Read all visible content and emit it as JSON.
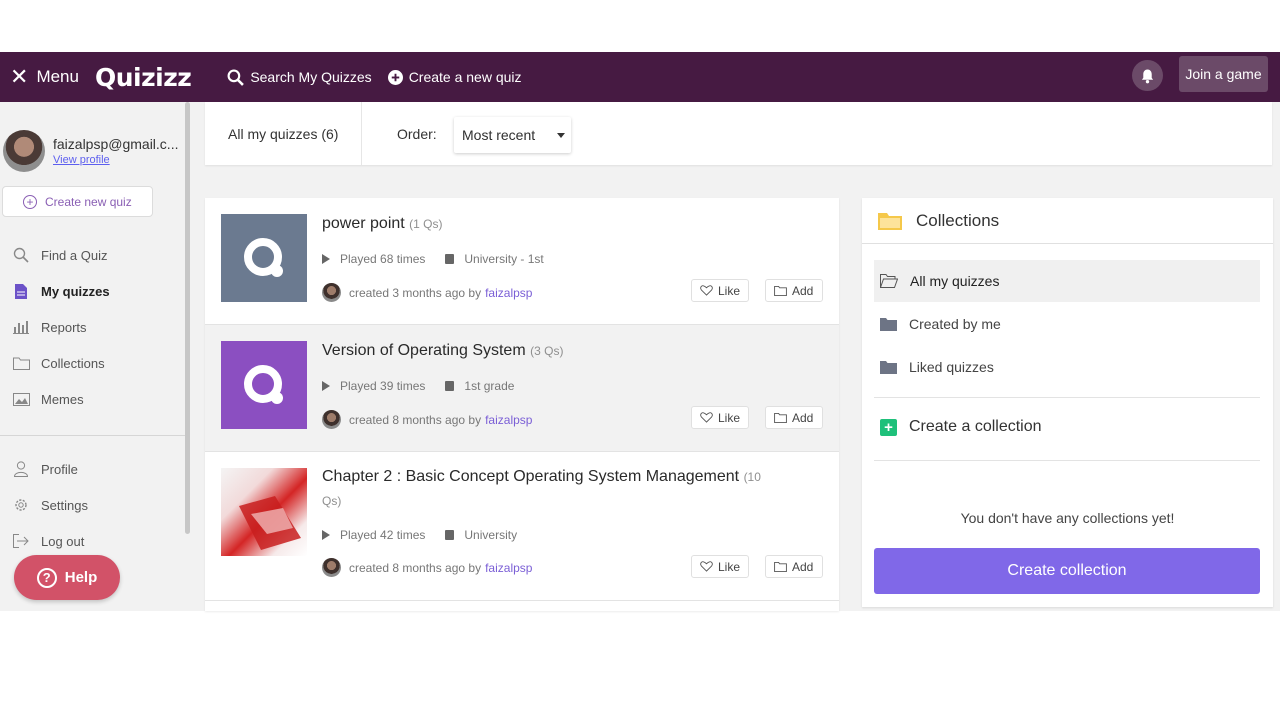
{
  "topbar": {
    "menu_label": "Menu",
    "logo": "Quizizz",
    "search_link": "Search My Quizzes",
    "create_link": "Create a new quiz",
    "join_button": "Join a game",
    "colors": {
      "bar": "#461a42",
      "button": "#6b4a68"
    }
  },
  "sidebar": {
    "email": "faizalpsp@gmail.c...",
    "view_profile": "View profile",
    "create_new_quiz": "Create new quiz",
    "nav": [
      {
        "label": "Find a Quiz",
        "icon": "search-icon"
      },
      {
        "label": "My quizzes",
        "icon": "document-icon",
        "active": true
      },
      {
        "label": "Reports",
        "icon": "bar-chart-icon"
      },
      {
        "label": "Collections",
        "icon": "folder-icon"
      },
      {
        "label": "Memes",
        "icon": "image-icon"
      }
    ],
    "account": [
      {
        "label": "Profile",
        "icon": "user-icon"
      },
      {
        "label": "Settings",
        "icon": "gear-icon"
      },
      {
        "label": "Log out",
        "icon": "logout-icon"
      }
    ],
    "help": "Help"
  },
  "filters": {
    "all_label": "All my quizzes (6)",
    "order_label": "Order:",
    "order_value": "Most recent"
  },
  "quizzes": [
    {
      "title": "power point",
      "qs": "(1 Qs)",
      "played": "Played 68 times",
      "grade": "University - 1st",
      "created": "created 3 months ago by",
      "user": "faizalpsp",
      "thumb_color": "#6b7a90"
    },
    {
      "title": "Version of Operating System",
      "qs": "(3 Qs)",
      "played": "Played 39 times",
      "grade": "1st grade",
      "created": "created 8 months ago by",
      "user": "faizalpsp",
      "thumb_color": "#8b4fc1"
    },
    {
      "title": "Chapter 2 : Basic Concept Operating System Management",
      "qs": "(10",
      "qs2": "Qs)",
      "played": "Played 42 times",
      "grade": "University",
      "created": "created 8 months ago by",
      "user": "faizalpsp",
      "thumb_color": "#d42525"
    }
  ],
  "actions": {
    "like": "Like",
    "add": "Add"
  },
  "collections": {
    "title": "Collections",
    "items": [
      {
        "label": "All my quizzes",
        "active": true
      },
      {
        "label": "Created by me"
      },
      {
        "label": "Liked quizzes"
      }
    ],
    "create_link": "Create a collection",
    "empty_text": "You don't have any collections yet!",
    "create_button": "Create collection",
    "button_color": "#8068e8"
  }
}
